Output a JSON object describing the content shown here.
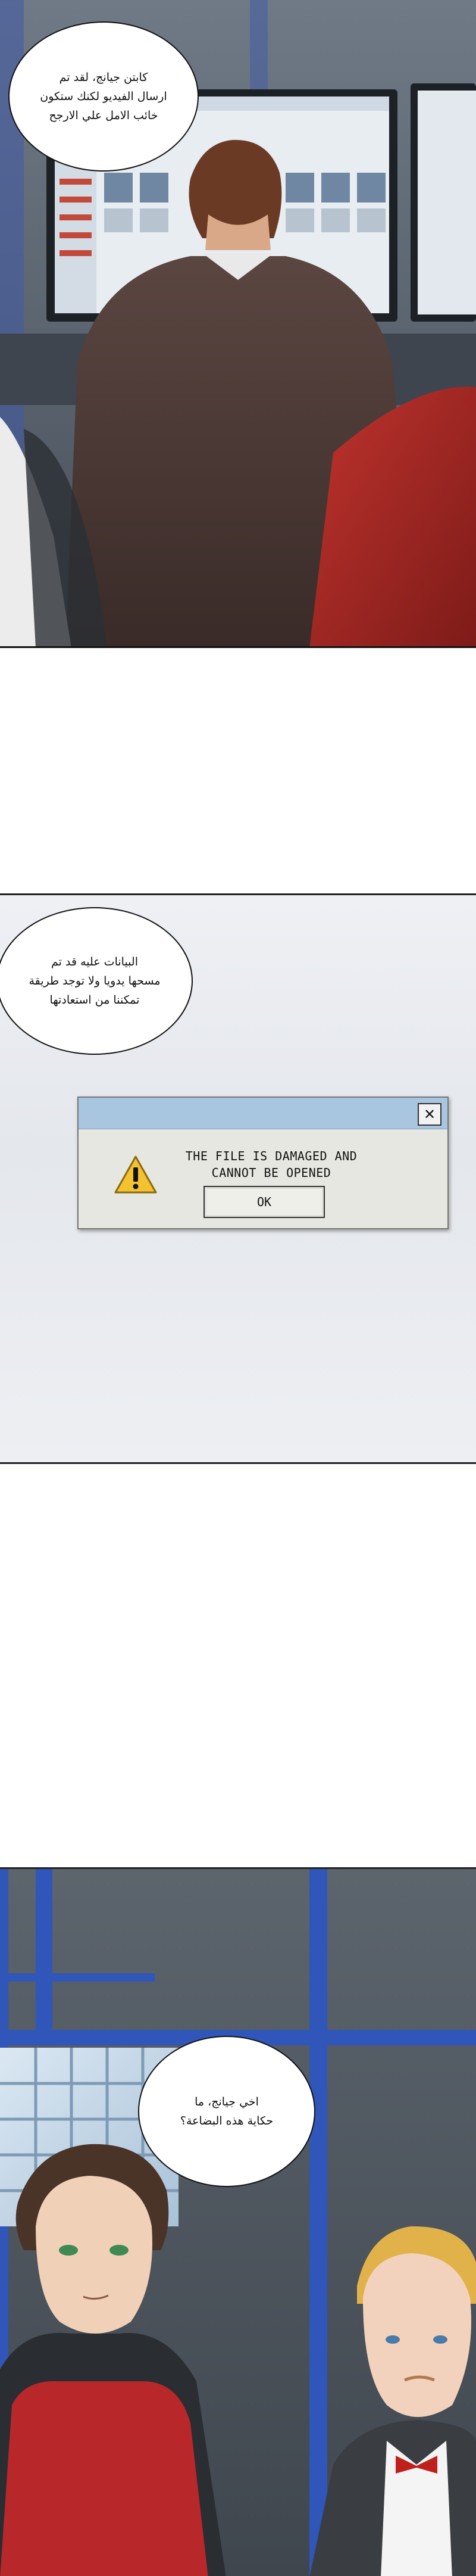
{
  "panel1": {
    "bubble_text": "كابتن جيانج، لقد تم\nارسال الفيديو لكنك ستكون\nخائب الامل علي الارجح"
  },
  "panel2": {
    "bubble_text": "البيانات عليه قد تم\nمسحها يدويا ولا توجد طريقة\nتمكننا من استعادتها",
    "dialog": {
      "close_label": "✕",
      "message_line1": "THE FILE IS DAMAGED AND",
      "message_line2": "CANNOT BE OPENED",
      "ok_label": "OK",
      "icon": "warning-icon"
    }
  },
  "panel3": {
    "bubble_text": "اخي جيانج، ما\nحكاية هذه البضاعة؟"
  }
}
